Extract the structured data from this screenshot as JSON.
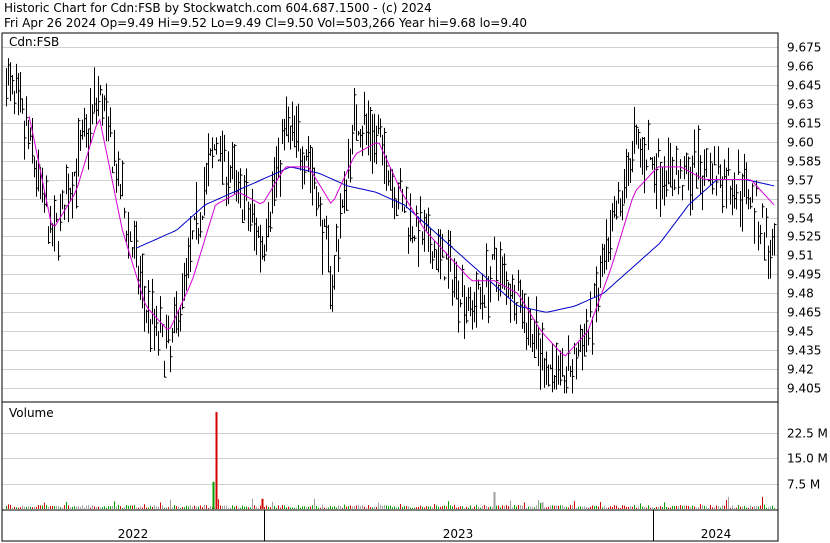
{
  "header": {
    "line1": "Historic Chart for Cdn:FSB by Stockwatch.com 604.687.1500 - (c) 2024",
    "line2": "Fri Apr 26 2024  Op=9.49  Hi=9.52  Lo=9.49  Cl=9.50  Vol=503,266  Year hi=9.68  lo=9.40"
  },
  "colors": {
    "price": "#000000",
    "ma_short": "#d400d4",
    "ma_long": "#0000c8",
    "vol_up": "#00a000",
    "vol_down": "#d00000",
    "vol_flat": "#a0a0a0",
    "frame": "#000000",
    "background": "#ffffff"
  },
  "chart_data": [
    {
      "type": "line",
      "panel": "price",
      "label": "Cdn:FSB",
      "y_ticks": [
        "9.675",
        "9.66",
        "9.645",
        "9.63",
        "9.615",
        "9.60",
        "9.585",
        "9.57",
        "9.555",
        "9.54",
        "9.525",
        "9.51",
        "9.495",
        "9.48",
        "9.465",
        "9.45",
        "9.435",
        "9.42",
        "9.405"
      ],
      "ylim": [
        9.395,
        9.685
      ],
      "grid": true,
      "x_axis_labels": [
        "2022",
        "2023",
        "2024"
      ],
      "series": [
        {
          "style": "ohlc-bars",
          "monthly_closes": [
            9.65,
            9.6,
            9.52,
            9.58,
            9.64,
            9.55,
            9.47,
            9.43,
            9.52,
            9.6,
            9.56,
            9.52,
            9.61,
            9.59,
            9.49,
            9.62,
            9.6,
            9.55,
            9.52,
            9.5,
            9.47,
            9.5,
            9.48,
            9.43,
            9.41,
            9.45,
            9.52,
            9.6,
            9.58,
            9.57,
            9.58,
            9.57,
            9.56,
            9.5
          ]
        },
        {
          "style": "moving-average-short",
          "monthly_values": [
            9.64,
            9.62,
            9.53,
            9.56,
            9.62,
            9.53,
            9.47,
            9.45,
            9.49,
            9.55,
            9.56,
            9.55,
            9.58,
            9.58,
            9.55,
            9.59,
            9.6,
            9.56,
            9.53,
            9.51,
            9.49,
            9.49,
            9.48,
            9.45,
            9.43,
            9.45,
            9.5,
            9.56,
            9.58,
            9.58,
            9.57,
            9.57,
            9.57,
            9.55
          ]
        },
        {
          "style": "moving-average-long",
          "monthly_values": [
            9.57,
            9.55,
            9.53,
            9.52,
            9.51,
            9.52,
            9.53,
            9.55,
            9.56,
            9.57,
            9.58,
            9.575,
            9.565,
            9.56,
            9.55,
            9.53,
            9.51,
            9.49,
            9.47,
            9.465,
            9.47,
            9.48,
            9.5,
            9.52,
            9.55,
            9.57,
            9.57,
            9.565
          ]
        }
      ]
    },
    {
      "type": "bar",
      "panel": "volume",
      "label": "Volume",
      "y_ticks": [
        "22.5 M",
        "15.0 M",
        "7.5 M"
      ],
      "ylim": [
        0,
        30
      ],
      "unit": "M",
      "spikes": [
        {
          "month_index": 9,
          "value": 28.5,
          "color": "vol_down"
        },
        {
          "month_index": 9,
          "value": 8.0,
          "color": "vol_up"
        },
        {
          "month_index": 11,
          "value": 3.0,
          "color": "vol_down"
        },
        {
          "month_index": 21,
          "value": 5.0,
          "color": "vol_flat"
        },
        {
          "month_index": 23,
          "value": 2.0,
          "color": "vol_flat"
        }
      ]
    }
  ]
}
